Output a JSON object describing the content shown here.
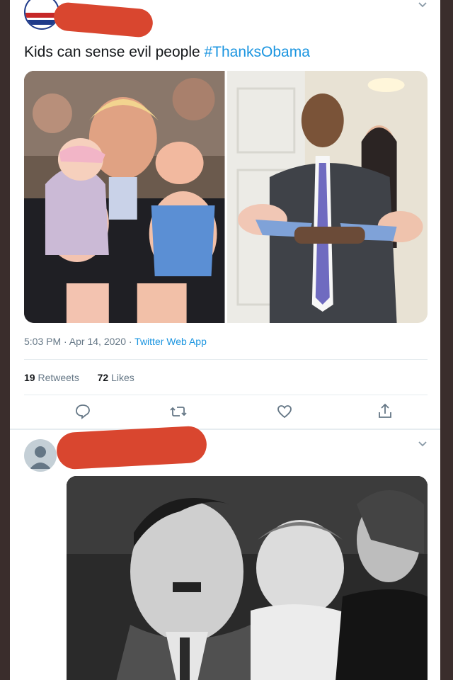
{
  "tweet1": {
    "text_plain": "Kids can sense evil people ",
    "hashtag": "#ThanksObama",
    "timestamp": "5:03 PM · Apr 14, 2020 · ",
    "source": "Twitter Web App",
    "retweets_count": "19",
    "retweets_label": " Retweets",
    "likes_count": "72",
    "likes_label": " Likes"
  },
  "icons": {
    "more": "chevron-down-icon",
    "reply": "reply-icon",
    "retweet": "retweet-icon",
    "like": "heart-icon",
    "share": "share-icon"
  },
  "colors": {
    "text": "#14171a",
    "secondary": "#657786",
    "link": "#1b95e0",
    "redaction": "#d9462f",
    "frame": "#3a2d2c"
  }
}
